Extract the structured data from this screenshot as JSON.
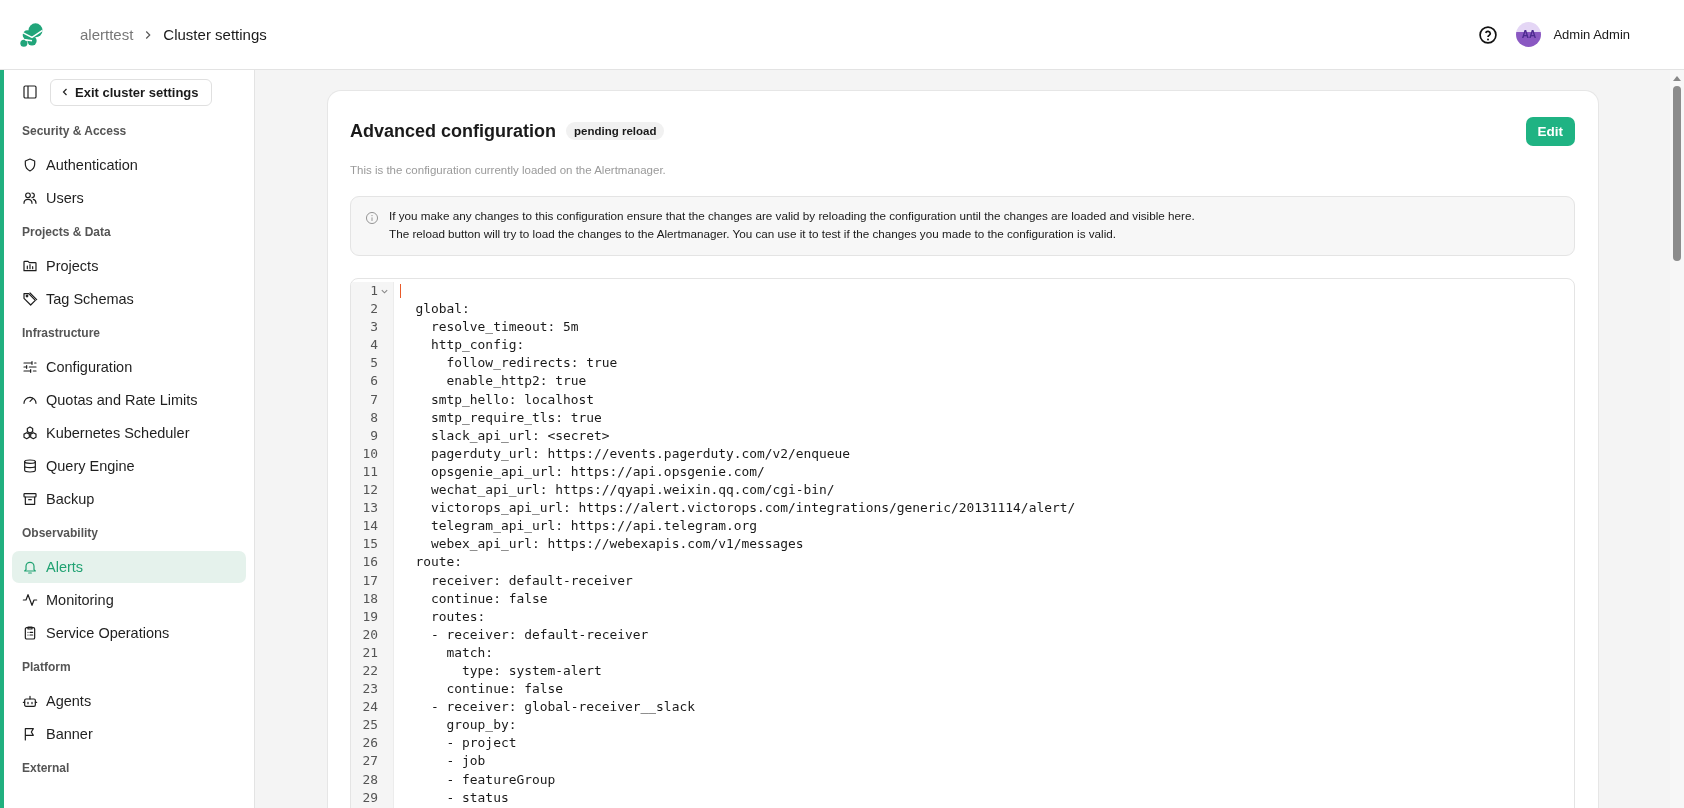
{
  "header": {
    "breadcrumbs": [
      {
        "label": "alerttest",
        "current": false
      },
      {
        "label": "Cluster settings",
        "current": true
      }
    ],
    "user": {
      "initials": "AA",
      "name": "Admin Admin"
    }
  },
  "sidebar": {
    "exit_button": "Exit cluster settings",
    "sections": [
      {
        "title": "Security & Access",
        "items": [
          {
            "label": "Authentication",
            "selected": false
          },
          {
            "label": "Users",
            "selected": false
          }
        ]
      },
      {
        "title": "Projects & Data",
        "items": [
          {
            "label": "Projects",
            "selected": false
          },
          {
            "label": "Tag Schemas",
            "selected": false
          }
        ]
      },
      {
        "title": "Infrastructure",
        "items": [
          {
            "label": "Configuration",
            "selected": false
          },
          {
            "label": "Quotas and Rate Limits",
            "selected": false
          },
          {
            "label": "Kubernetes Scheduler",
            "selected": false
          },
          {
            "label": "Query Engine",
            "selected": false
          },
          {
            "label": "Backup",
            "selected": false
          }
        ]
      },
      {
        "title": "Observability",
        "items": [
          {
            "label": "Alerts",
            "selected": true
          },
          {
            "label": "Monitoring",
            "selected": false
          },
          {
            "label": "Service Operations",
            "selected": false
          }
        ]
      },
      {
        "title": "Platform",
        "items": [
          {
            "label": "Agents",
            "selected": false
          },
          {
            "label": "Banner",
            "selected": false
          }
        ]
      },
      {
        "title": "External"
      }
    ]
  },
  "card": {
    "title": "Advanced configuration",
    "badge": "pending reload",
    "edit_button": "Edit",
    "description": "This is the configuration currently loaded on the Alertmanager.",
    "info_lines": [
      "If you make any changes to this configuration ensure that the changes are valid by reloading the configuration until the changes are loaded and visible here.",
      "The reload button will try to load the changes to the Alertmanager. You can use it to test if the changes you made to the configuration is valid."
    ],
    "code_lines": [
      {
        "number": "1",
        "fold": true,
        "cursor": true
      },
      {
        "number": "2",
        "text": "  global:",
        "fold": false,
        "cursor": false
      },
      {
        "number": "3",
        "text": "    resolve_timeout: 5m",
        "fold": false,
        "cursor": false
      },
      {
        "number": "4",
        "text": "    http_config:",
        "fold": false,
        "cursor": false
      },
      {
        "number": "5",
        "text": "      follow_redirects: true",
        "fold": false,
        "cursor": false
      },
      {
        "number": "6",
        "text": "      enable_http2: true",
        "fold": false,
        "cursor": false
      },
      {
        "number": "7",
        "text": "    smtp_hello: localhost",
        "fold": false,
        "cursor": false
      },
      {
        "number": "8",
        "text": "    smtp_require_tls: true",
        "fold": false,
        "cursor": false
      },
      {
        "number": "9",
        "text": "    slack_api_url: <secret>",
        "fold": false,
        "cursor": false
      },
      {
        "number": "10",
        "text": "    pagerduty_url: https://events.pagerduty.com/v2/enqueue",
        "fold": false,
        "cursor": false
      },
      {
        "number": "11",
        "text": "    opsgenie_api_url: https://api.opsgenie.com/",
        "fold": false,
        "cursor": false
      },
      {
        "number": "12",
        "text": "    wechat_api_url: https://qyapi.weixin.qq.com/cgi-bin/",
        "fold": false,
        "cursor": false
      },
      {
        "number": "13",
        "text": "    victorops_api_url: https://alert.victorops.com/integrations/generic/20131114/alert/",
        "fold": false,
        "cursor": false
      },
      {
        "number": "14",
        "text": "    telegram_api_url: https://api.telegram.org",
        "fold": false,
        "cursor": false
      },
      {
        "number": "15",
        "text": "    webex_api_url: https://webexapis.com/v1/messages",
        "fold": false,
        "cursor": false
      },
      {
        "number": "16",
        "text": "  route:",
        "fold": false,
        "cursor": false
      },
      {
        "number": "17",
        "text": "    receiver: default-receiver",
        "fold": false,
        "cursor": false
      },
      {
        "number": "18",
        "text": "    continue: false",
        "fold": false,
        "cursor": false
      },
      {
        "number": "19",
        "text": "    routes:",
        "fold": false,
        "cursor": false
      },
      {
        "number": "20",
        "text": "    - receiver: default-receiver",
        "fold": false,
        "cursor": false
      },
      {
        "number": "21",
        "text": "      match:",
        "fold": false,
        "cursor": false
      },
      {
        "number": "22",
        "text": "        type: system-alert",
        "fold": false,
        "cursor": false
      },
      {
        "number": "23",
        "text": "      continue: false",
        "fold": false,
        "cursor": false
      },
      {
        "number": "24",
        "text": "    - receiver: global-receiver__slack",
        "fold": false,
        "cursor": false
      },
      {
        "number": "25",
        "text": "      group_by:",
        "fold": false,
        "cursor": false
      },
      {
        "number": "26",
        "text": "      - project",
        "fold": false,
        "cursor": false
      },
      {
        "number": "27",
        "text": "      - job",
        "fold": false,
        "cursor": false
      },
      {
        "number": "28",
        "text": "      - featureGroup",
        "fold": false,
        "cursor": false
      },
      {
        "number": "29",
        "text": "      - status",
        "fold": false,
        "cursor": false
      }
    ]
  }
}
